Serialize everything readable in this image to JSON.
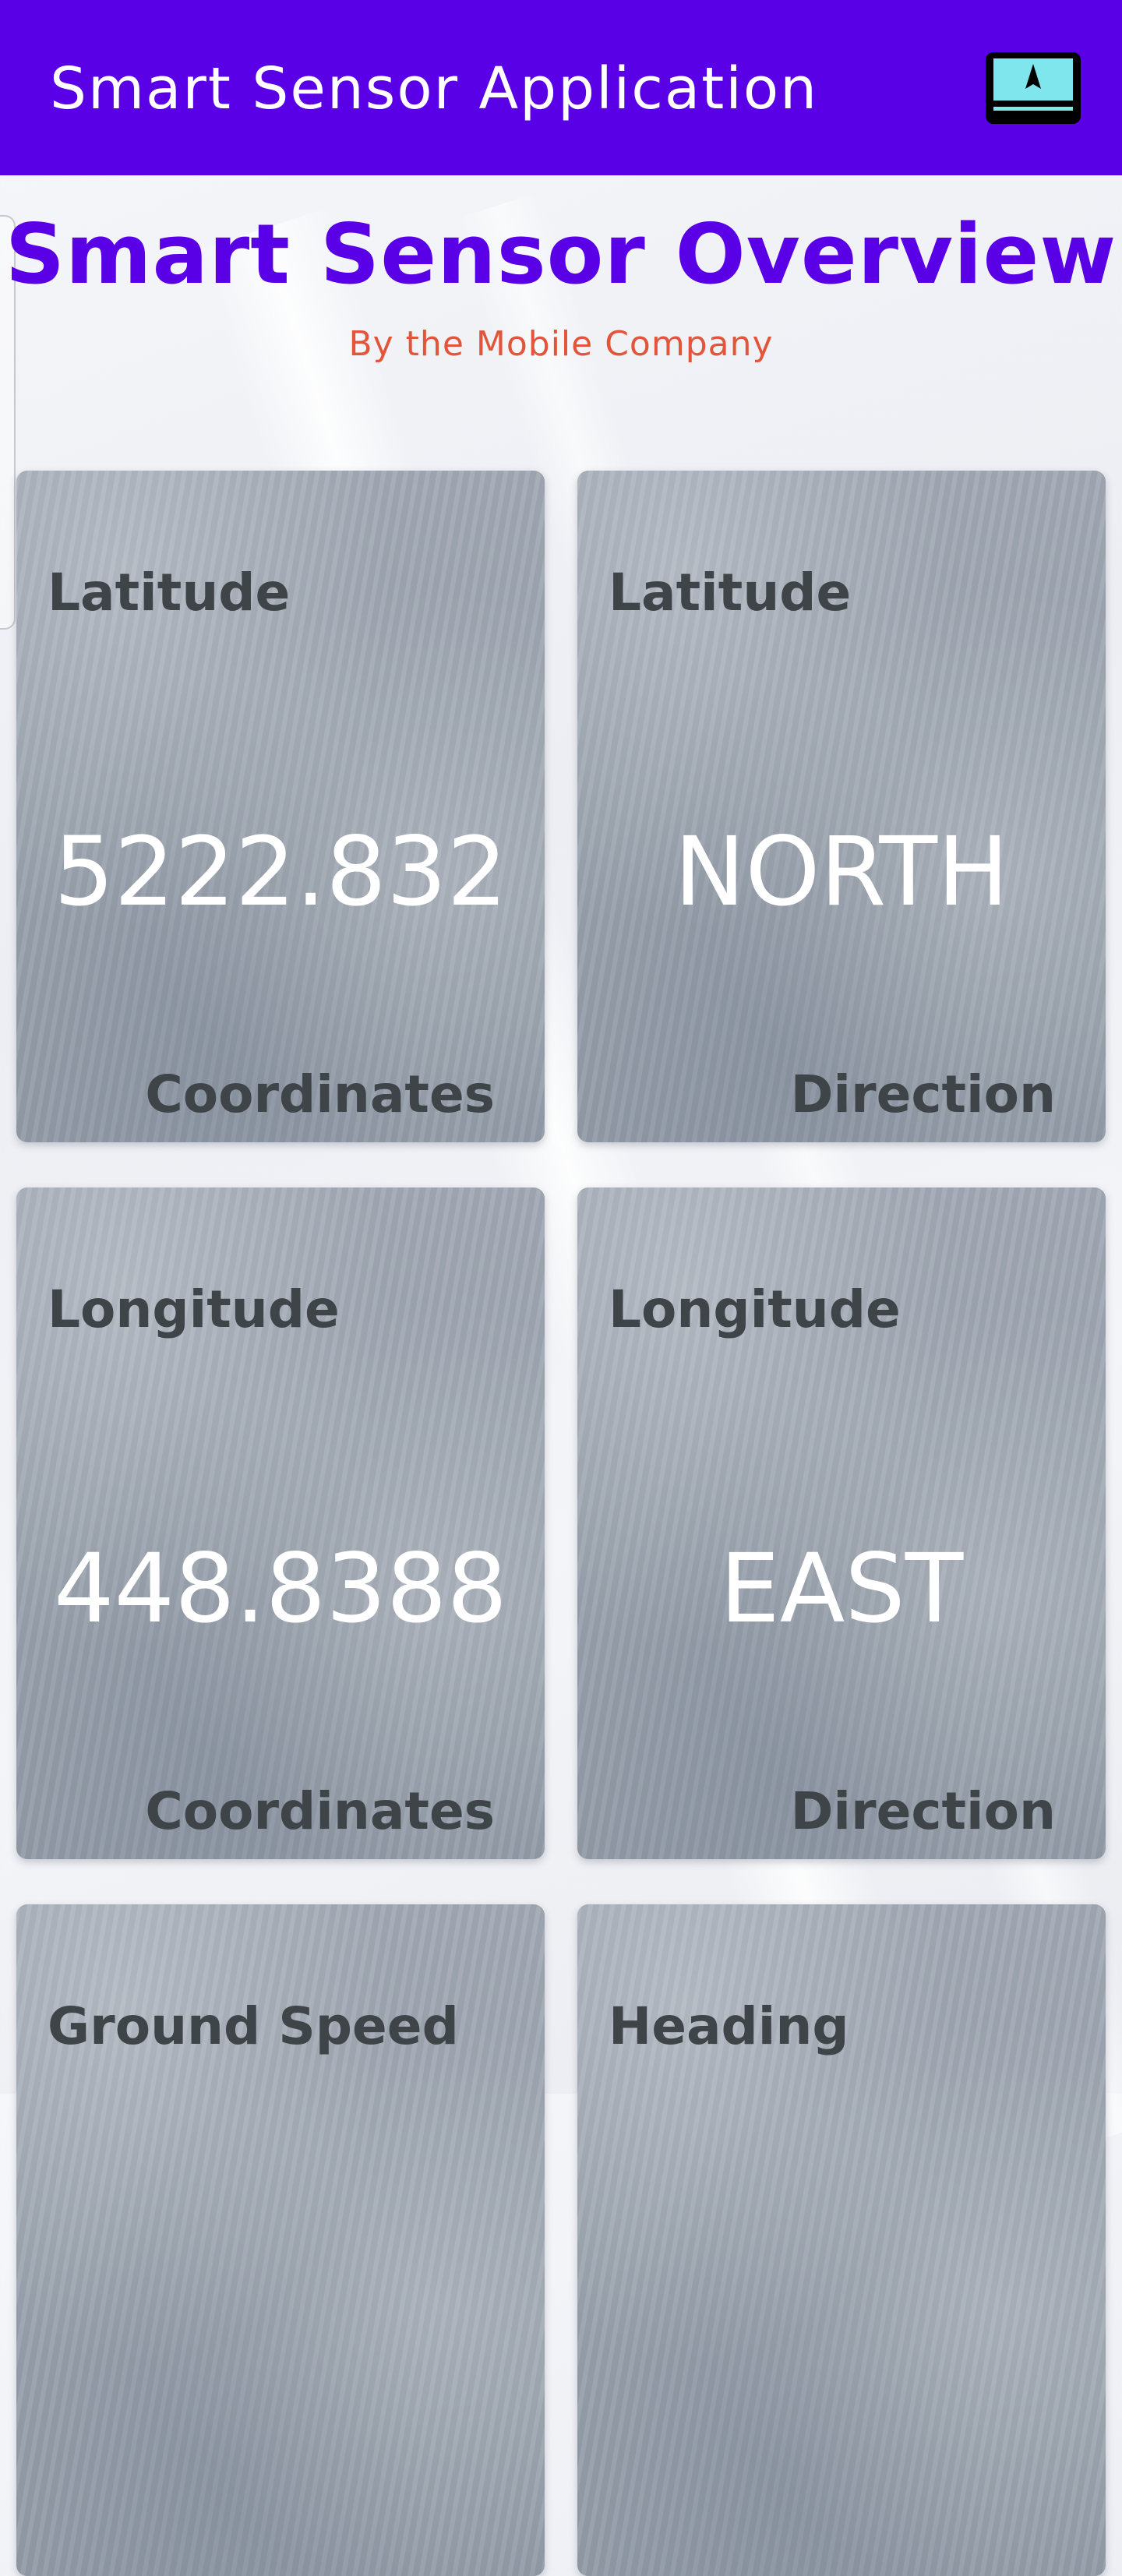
{
  "app_bar": {
    "title": "Smart Sensor Application",
    "action_icon": "cast-screen-icon",
    "background_color": "#5a00e6"
  },
  "header": {
    "title": "Smart Sensor Overview",
    "subtitle": "By the Mobile Company",
    "title_color": "#5a00e6",
    "subtitle_color": "#e2553a"
  },
  "cards": [
    {
      "top_label": "Latitude",
      "value": "5222.832",
      "bottom_label": "Coordinates"
    },
    {
      "top_label": "Latitude",
      "value": "NORTH",
      "bottom_label": "Direction"
    },
    {
      "top_label": "Longitude",
      "value": "448.8388",
      "bottom_label": "Coordinates"
    },
    {
      "top_label": "Longitude",
      "value": "EAST",
      "bottom_label": "Direction"
    },
    {
      "top_label": "Ground Speed"
    },
    {
      "top_label": "Heading"
    }
  ]
}
